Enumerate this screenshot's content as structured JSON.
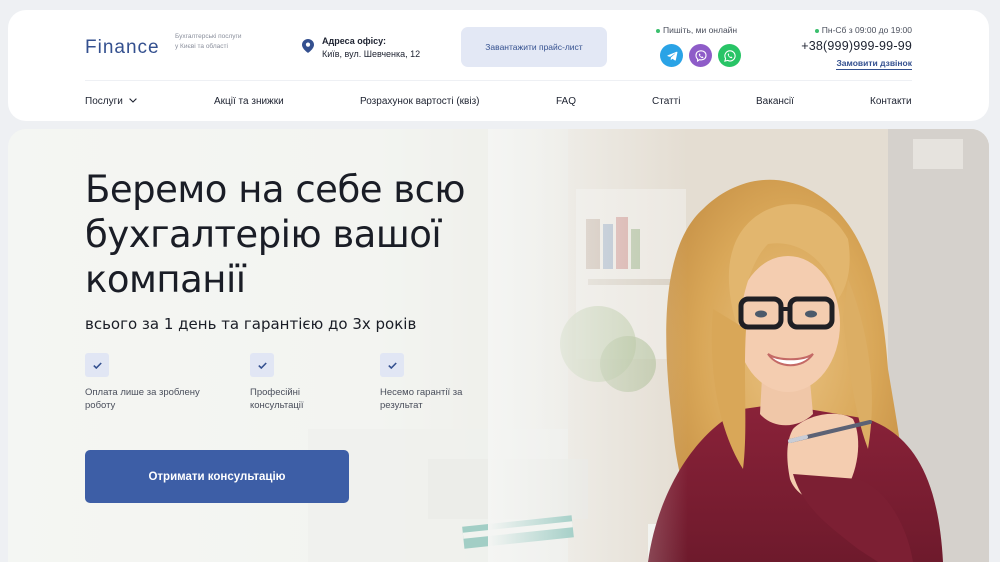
{
  "header": {
    "logo": "Finance",
    "tagline": "Бухгалтерські послуги у Києві та області",
    "address": {
      "title": "Адреса офісу:",
      "value": "Київ, вул. Шевченка, 12"
    },
    "price_button": "Завантажити прайс-лист",
    "online_label": "Пишіть, ми онлайн",
    "social": [
      "telegram-icon",
      "viber-icon",
      "whatsapp-icon"
    ],
    "hours": "Пн-Сб з 09:00 до 19:00",
    "phone": "+38(999)999-99-99",
    "callback_link": "Замовити дзвінок"
  },
  "nav": {
    "items": [
      {
        "label": "Послуги",
        "has_dropdown": true
      },
      {
        "label": "Акції та знижки"
      },
      {
        "label": "Розрахунок вартості (квіз)"
      },
      {
        "label": "FAQ"
      },
      {
        "label": "Статті"
      },
      {
        "label": "Вакансії"
      },
      {
        "label": "Контакти"
      }
    ]
  },
  "hero": {
    "title": "Беремо на себе всю бухгалтерію вашої компанії",
    "subtitle": "всього за 1 день та гарантією до 3х років",
    "features": [
      {
        "text": "Оплата лише за зроблену роботу"
      },
      {
        "text": "Професійні консультації"
      },
      {
        "text": "Несемо гарантії за результат"
      }
    ],
    "cta": "Отримати консультацію"
  },
  "colors": {
    "brand": "#34508f",
    "cta": "#3d5ea6",
    "telegram": "#2aa3e6",
    "viber": "#8e5cc8",
    "whatsapp": "#28c466",
    "online_dot": "#3bbf6e"
  }
}
